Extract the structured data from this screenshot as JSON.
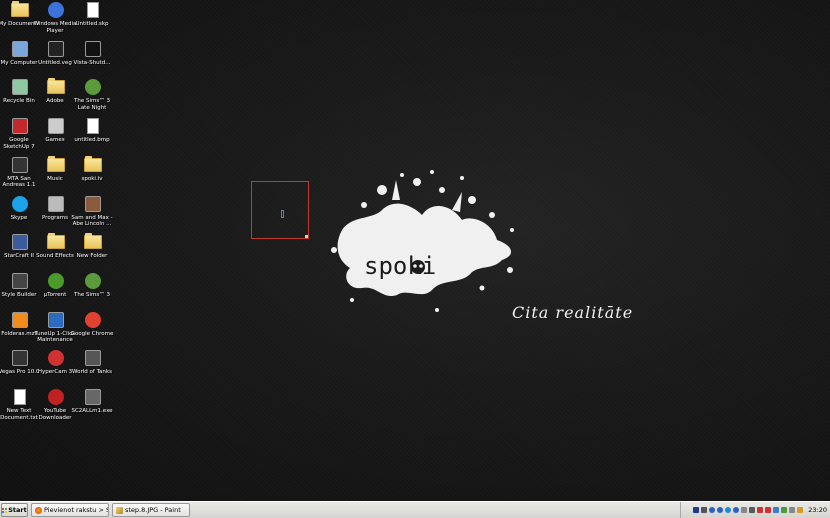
{
  "desktop_icons": [
    {
      "label": "My Documents",
      "icon": "my-documents-icon"
    },
    {
      "label": "Windows Media Player",
      "icon": "media-player-icon"
    },
    {
      "label": "Untitled.skp",
      "icon": "sketchup-file-icon"
    },
    {
      "label": "My Computer",
      "icon": "computer-icon"
    },
    {
      "label": "Untitled.veg",
      "icon": "vegas-file-icon"
    },
    {
      "label": "Vista-Shutd...",
      "icon": "shutdown-icon"
    },
    {
      "label": "Recycle Bin",
      "icon": "recycle-bin-icon"
    },
    {
      "label": "Adobe",
      "icon": "folder-icon"
    },
    {
      "label": "The Sims™ 3 Late Night",
      "icon": "sims-icon"
    },
    {
      "label": "Google SketchUp 7",
      "icon": "sketchup-icon"
    },
    {
      "label": "Games",
      "icon": "games-icon"
    },
    {
      "label": "untitled.bmp",
      "icon": "image-file-icon"
    },
    {
      "label": "MTA San Andreas 1.1",
      "icon": "mta-icon"
    },
    {
      "label": "Music",
      "icon": "folder-icon"
    },
    {
      "label": "spoki.lv",
      "icon": "folder-icon"
    },
    {
      "label": "Skype",
      "icon": "skype-icon"
    },
    {
      "label": "Programs",
      "icon": "programs-icon"
    },
    {
      "label": "Sam and Max - Abe Lincoln ...",
      "icon": "game-icon"
    },
    {
      "label": "StarCraft II",
      "icon": "starcraft-icon"
    },
    {
      "label": "Sound Effects",
      "icon": "folder-icon"
    },
    {
      "label": "New Folder",
      "icon": "folder-icon"
    },
    {
      "label": "Style Builder",
      "icon": "style-builder-icon"
    },
    {
      "label": "µTorrent",
      "icon": "utorrent-icon"
    },
    {
      "label": "The Sims™ 3",
      "icon": "sims-icon"
    },
    {
      "label": "Folderas.mzt",
      "icon": "vlc-icon"
    },
    {
      "label": "TuneUp 1-Click Maintenance",
      "icon": "tuneup-icon"
    },
    {
      "label": "Google Chrome",
      "icon": "chrome-icon"
    },
    {
      "label": "Vegas Pro 10.0",
      "icon": "vegas-icon"
    },
    {
      "label": "HyperCam 3",
      "icon": "hypercam-icon"
    },
    {
      "label": "World of Tanks",
      "icon": "world-of-tanks-icon"
    },
    {
      "label": "New Text Document.txt",
      "icon": "text-file-icon"
    },
    {
      "label": "YouTube Downloader",
      "icon": "youtube-downloader-icon"
    },
    {
      "label": "SC2ALLm1.exe",
      "icon": "exe-icon"
    }
  ],
  "wallpaper": {
    "logo_text": "spoki",
    "tagline": "Cita realitāte"
  },
  "taskbar": {
    "start_label": "Start",
    "tasks": [
      {
        "label": "Pievienot rakstu > Spoki.l...",
        "icon": "firefox-icon"
      },
      {
        "label": "step.8.JPG - Paint",
        "icon": "paint-icon"
      }
    ],
    "clock": "23:20"
  }
}
